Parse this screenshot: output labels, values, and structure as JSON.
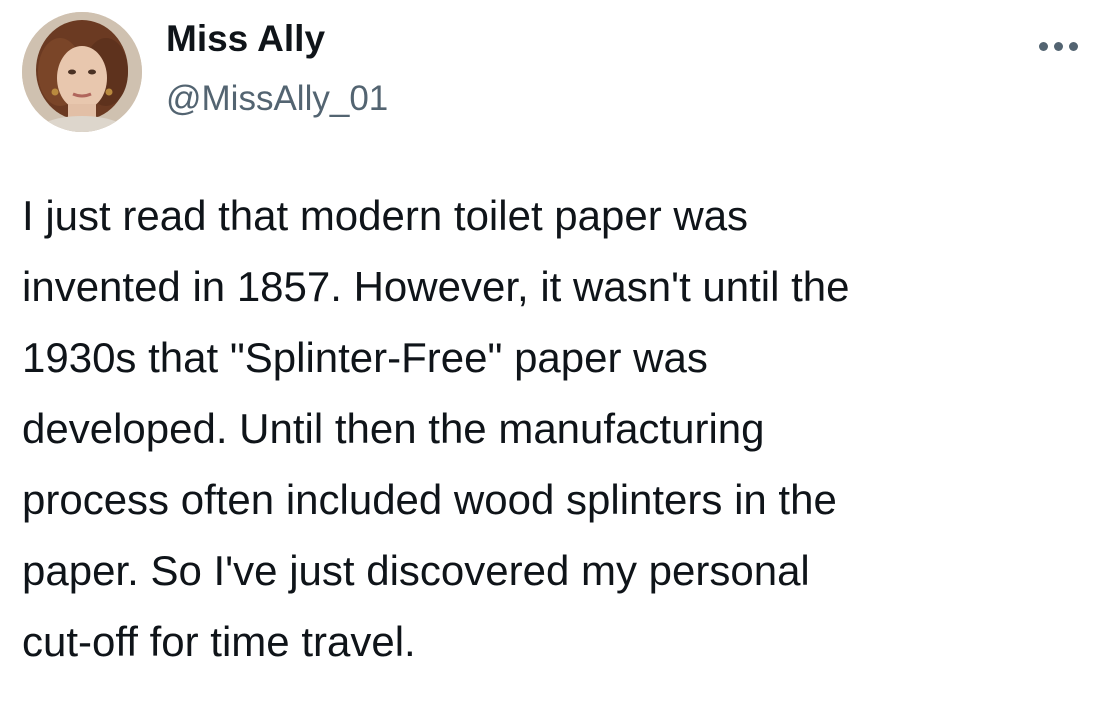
{
  "tweet": {
    "author": {
      "display_name": "Miss Ally",
      "handle": "@MissAlly_01",
      "avatar_icon": "profile-photo"
    },
    "more_icon": "ellipsis-icon",
    "text_lines": [
      "I just read that modern toilet paper was",
      "invented in 1857. However, it wasn't until the",
      "1930s that \"Splinter-Free\" paper was",
      "developed. Until then the manufacturing",
      "process often included wood splinters in the",
      "paper. So I've just discovered my personal",
      "cut-off for time travel."
    ]
  },
  "colors": {
    "text": "#0f1419",
    "secondary": "#536471",
    "background": "#ffffff"
  }
}
